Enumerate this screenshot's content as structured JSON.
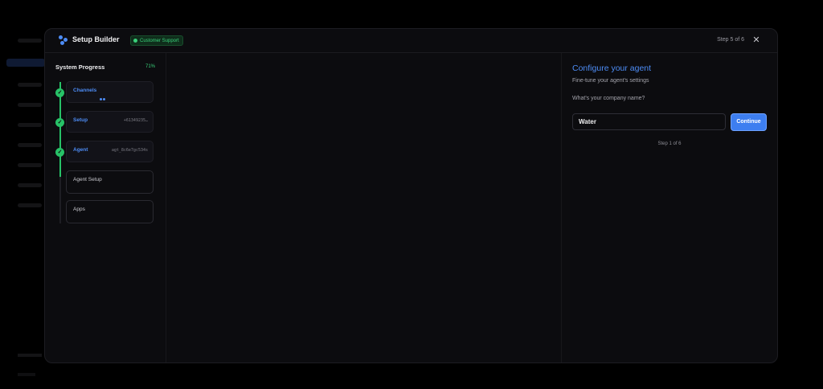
{
  "modal": {
    "title": "Setup Builder",
    "badge": "Customer Support",
    "step_indicator": "Step 5 of 6",
    "close_symbol": "✕"
  },
  "progress": {
    "title": "System Progress",
    "percent": "71%",
    "steps": [
      {
        "label": "Channels",
        "meta": "",
        "status": "complete"
      },
      {
        "label": "Setup",
        "meta": "+61349235…",
        "status": "complete"
      },
      {
        "label": "Agent",
        "meta": "agt_8c6e7gc534s",
        "status": "complete"
      },
      {
        "label": "Agent Setup",
        "meta": "",
        "status": "pending"
      },
      {
        "label": "Apps",
        "meta": "",
        "status": "pending"
      }
    ],
    "check_symbol": "✓"
  },
  "configure": {
    "title": "Configure your agent",
    "subtitle": "Fine-tune your agent's settings",
    "question": "What's your company name?",
    "input_value": "Water",
    "continue_label": "Continue",
    "step_count": "Step 1 of 6"
  },
  "colors": {
    "accent": "#4d8cf5",
    "success": "#27c267",
    "button": "#3d7ef0"
  },
  "icons": {
    "logo": "nodes-icon",
    "badge": "status-dot-icon",
    "close": "close-icon",
    "check": "check-icon"
  }
}
